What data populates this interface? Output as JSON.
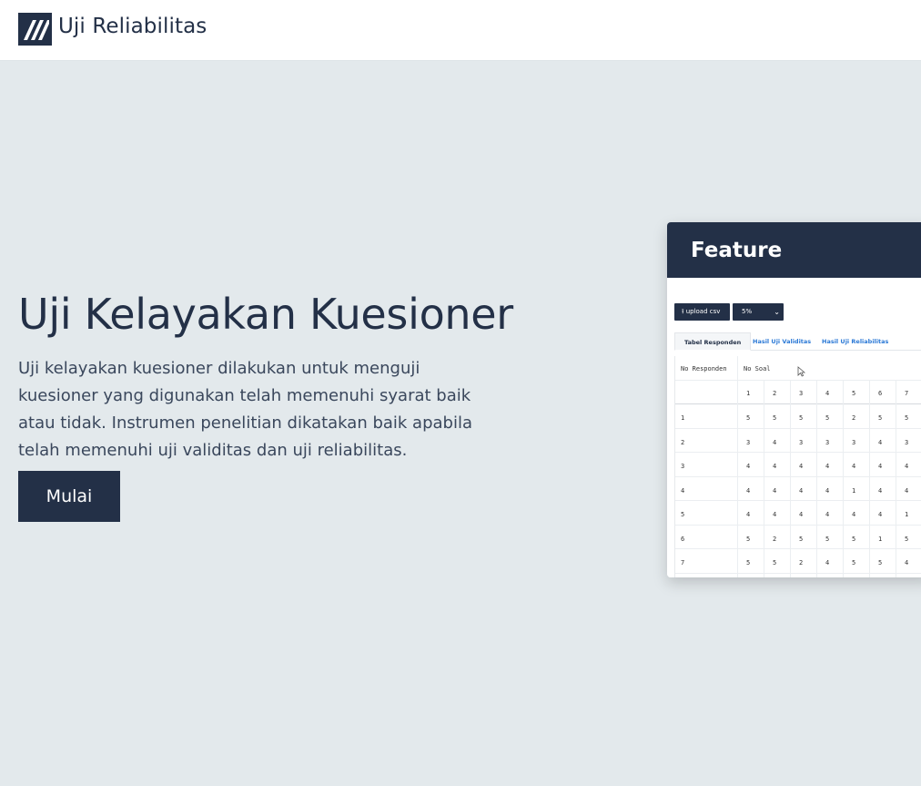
{
  "nav": {
    "brand": "Uji Reliabilitas",
    "logo_icon": "striped-logo-icon"
  },
  "hero": {
    "title": "Uji Kelayakan Kuesioner",
    "description": "Uji kelayakan kuesioner dilakukan untuk menguji kuesioner yang digunakan telah memenuhi syarat baik atau tidak. Instrumen penelitian dikatakan baik apabila telah memenuhi uji validitas dan uji reliabilitas.",
    "cta_label": "Mulai"
  },
  "feature": {
    "heading": "Feature",
    "preview": {
      "upload_label": "upload csv",
      "upload_icon": "upload-icon",
      "select_value": "5%",
      "select_icon": "chevron-down-icon",
      "tabs": [
        "Tabel Responden",
        "Hasil Uji Validitas",
        "Hasil Uji Reliabilitas"
      ],
      "col_header_respondent": "No Responden",
      "col_header_items": "No Soal",
      "item_numbers": [
        "1",
        "2",
        "3",
        "4",
        "5",
        "6",
        "7"
      ],
      "rows": [
        {
          "no": "1",
          "values": [
            "5",
            "5",
            "5",
            "5",
            "2",
            "5",
            "5"
          ]
        },
        {
          "no": "2",
          "values": [
            "3",
            "4",
            "3",
            "3",
            "3",
            "4",
            "3"
          ]
        },
        {
          "no": "3",
          "values": [
            "4",
            "4",
            "4",
            "4",
            "4",
            "4",
            "4"
          ]
        },
        {
          "no": "4",
          "values": [
            "4",
            "4",
            "4",
            "4",
            "1",
            "4",
            "4"
          ]
        },
        {
          "no": "5",
          "values": [
            "4",
            "4",
            "4",
            "4",
            "4",
            "4",
            "1"
          ]
        },
        {
          "no": "6",
          "values": [
            "5",
            "2",
            "5",
            "5",
            "5",
            "1",
            "5"
          ]
        },
        {
          "no": "7",
          "values": [
            "5",
            "5",
            "2",
            "4",
            "5",
            "5",
            "4"
          ]
        }
      ]
    }
  },
  "colors": {
    "primary": "#233047",
    "background": "#e3e9ec",
    "link": "#2b79d6"
  }
}
